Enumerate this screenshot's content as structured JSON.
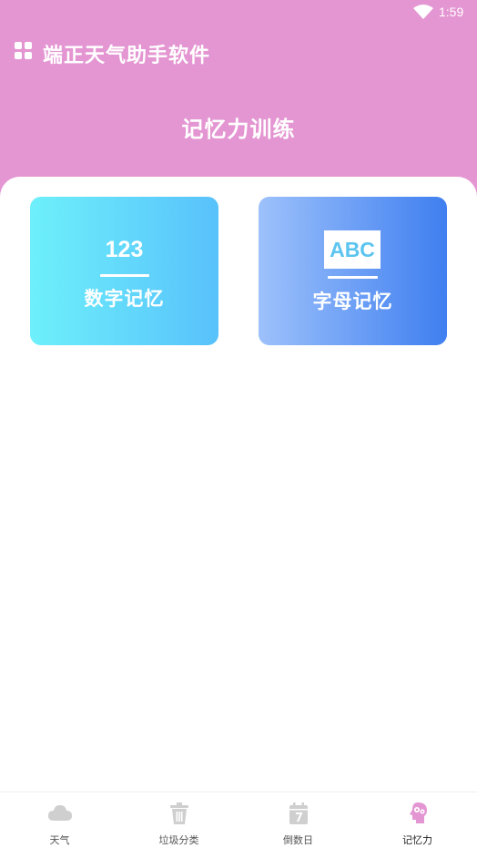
{
  "status": {
    "time": "1:59"
  },
  "app": {
    "title": "端正天气助手软件"
  },
  "page": {
    "title": "记忆力训练"
  },
  "cards": [
    {
      "glyph": "123",
      "label": "数字记忆",
      "colors": [
        "#6ef0fb",
        "#58c1fb"
      ]
    },
    {
      "glyph": "ABC",
      "label": "字母记忆",
      "colors": [
        "#9dc1fb",
        "#3f7ff0"
      ]
    }
  ],
  "nav": {
    "items": [
      {
        "label": "天气",
        "icon": "cloud-icon"
      },
      {
        "label": "垃圾分类",
        "icon": "trash-icon"
      },
      {
        "label": "倒数日",
        "icon": "calendar-icon"
      },
      {
        "label": "记忆力",
        "icon": "brain-icon",
        "active": true
      }
    ],
    "active_color": "#e496d2",
    "inactive_color": "#cfcfcf"
  }
}
